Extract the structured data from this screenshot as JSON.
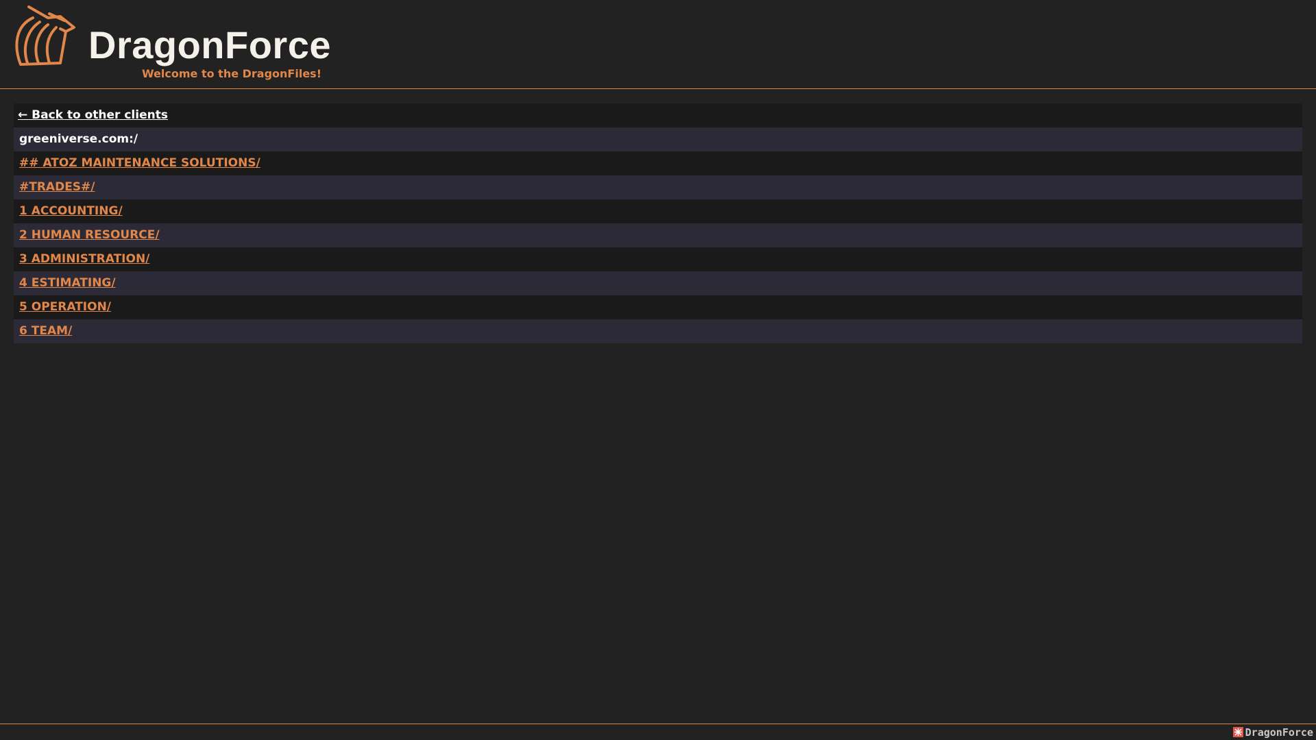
{
  "header": {
    "title": "DragonForce",
    "subtitle": "Welcome to the DragonFiles!",
    "logo_icon": "dragon-logo-icon",
    "accent_color": "#e2874a"
  },
  "listing": {
    "back_label": "← Back to other clients",
    "current_path": "greeniverse.com:/",
    "folders": [
      {
        "name": "## ATOZ MAINTENANCE SOLUTIONS/"
      },
      {
        "name": "#TRADES#/"
      },
      {
        "name": "1 ACCOUNTING/"
      },
      {
        "name": "2 HUMAN RESOURCE/"
      },
      {
        "name": "3 ADMINISTRATION/"
      },
      {
        "name": "4 ESTIMATING/"
      },
      {
        "name": "5 OPERATION/"
      },
      {
        "name": "6 TEAM/"
      }
    ]
  },
  "footer": {
    "brand": "DragonForce",
    "icon": "dragon-small-icon"
  }
}
